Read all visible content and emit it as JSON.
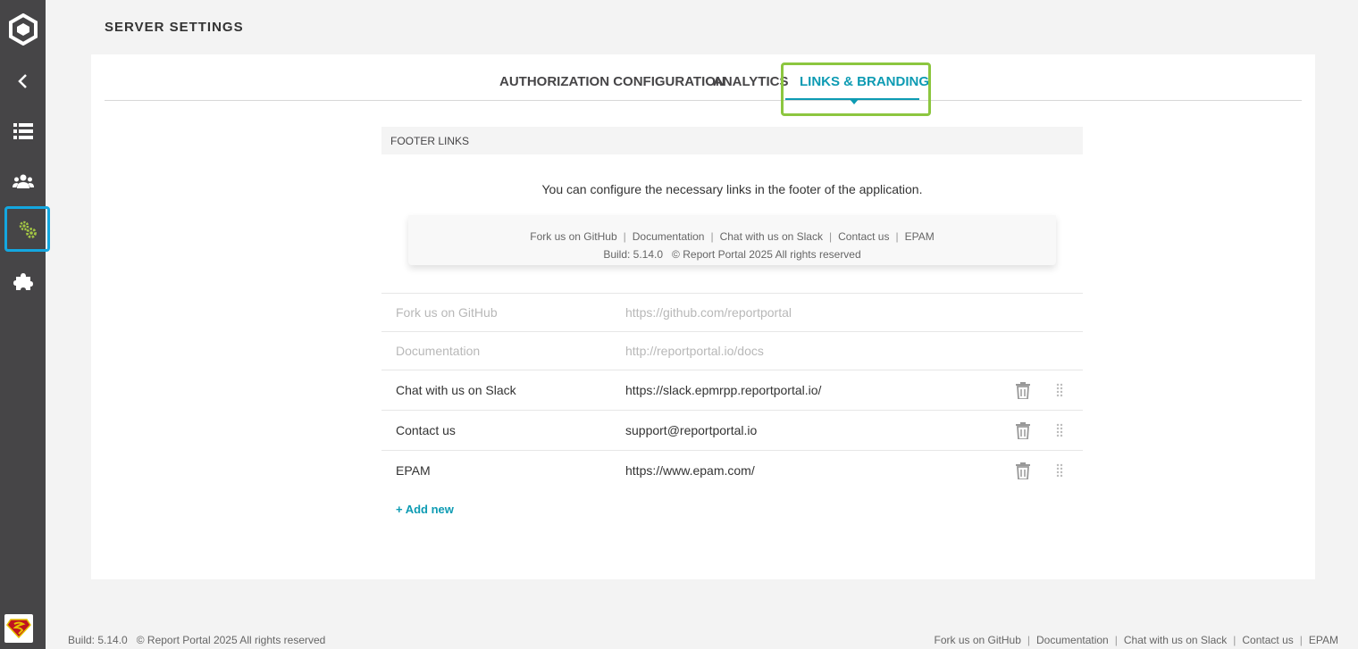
{
  "page": {
    "title": "SERVER SETTINGS"
  },
  "tabs": [
    {
      "label": "AUTHORIZATION CONFIGURATION",
      "active": false
    },
    {
      "label": "ANALYTICS",
      "active": false
    },
    {
      "label": "LINKS & BRANDING",
      "active": true
    }
  ],
  "section": {
    "header": "FOOTER LINKS",
    "description": "You can configure the necessary links in the footer of the application."
  },
  "preview": {
    "links": [
      "Fork us on GitHub",
      "Documentation",
      "Chat with us on Slack",
      "Contact us",
      "EPAM"
    ],
    "build": "Build: 5.14.0",
    "copyright": "© Report Portal 2025 All rights reserved"
  },
  "links": {
    "fixed": [
      {
        "name": "Fork us on GitHub",
        "url": "https://github.com/reportportal"
      },
      {
        "name": "Documentation",
        "url": "http://reportportal.io/docs"
      }
    ],
    "custom": [
      {
        "name": "Chat with us on Slack",
        "url": "https://slack.epmrpp.reportportal.io/"
      },
      {
        "name": "Contact us",
        "url": "support@reportportal.io"
      },
      {
        "name": "EPAM",
        "url": "https://www.epam.com/"
      }
    ],
    "add_new_label": "+ Add new"
  },
  "footer": {
    "build": "Build: 5.14.0",
    "copyright": "© Report Portal 2025 All rights reserved",
    "links": [
      "Fork us on GitHub",
      "Documentation",
      "Chat with us on Slack",
      "Contact us",
      "EPAM"
    ]
  },
  "colors": {
    "sidebar": "#464547",
    "accent": "#0d9bb3",
    "tab_highlight": "#8cc63f",
    "sidebar_highlight": "#14a7e0",
    "settings_icon": "#a3c644"
  },
  "icons": {
    "sidebar": [
      "logo-icon",
      "back-icon",
      "launches-icon",
      "users-icon",
      "settings-icon",
      "plugins-icon"
    ],
    "row_actions": [
      "trash-icon",
      "drag-handle-icon"
    ]
  }
}
